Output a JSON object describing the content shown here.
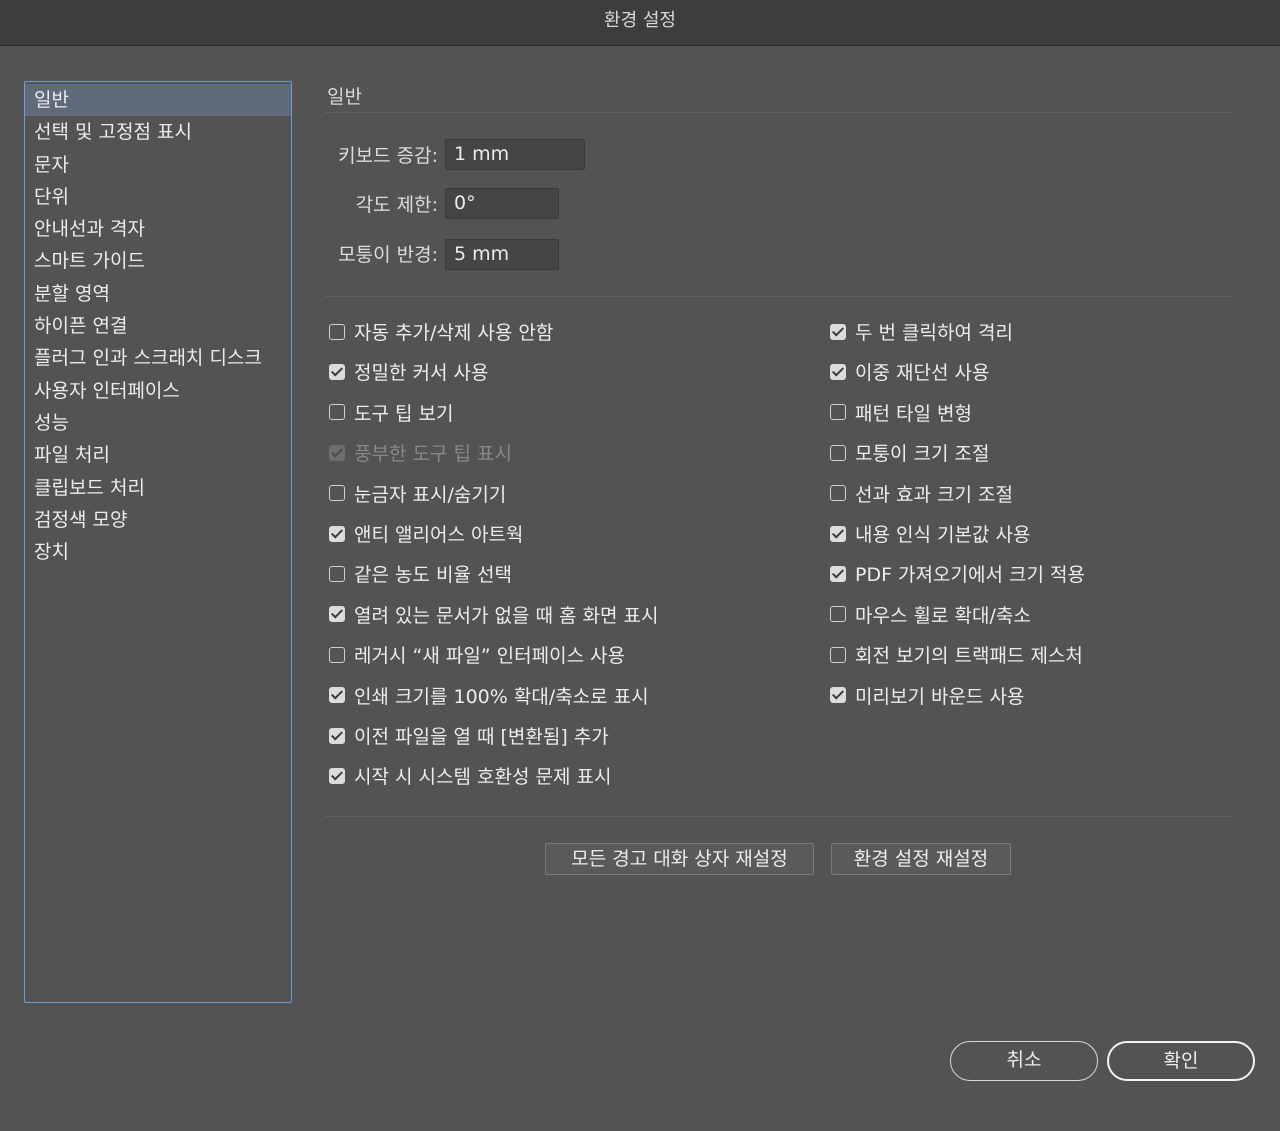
{
  "window": {
    "title": "환경 설정"
  },
  "sidebar": {
    "items": [
      {
        "label": "일반",
        "active": true
      },
      {
        "label": "선택 및 고정점 표시"
      },
      {
        "label": "문자"
      },
      {
        "label": "단위"
      },
      {
        "label": "안내선과 격자"
      },
      {
        "label": "스마트 가이드"
      },
      {
        "label": "분할 영역"
      },
      {
        "label": "하이픈 연결"
      },
      {
        "label": "플러그 인과 스크래치 디스크"
      },
      {
        "label": "사용자 인터페이스"
      },
      {
        "label": "성능"
      },
      {
        "label": "파일 처리"
      },
      {
        "label": "클립보드 처리"
      },
      {
        "label": "검정색 모양"
      },
      {
        "label": "장치"
      }
    ]
  },
  "main": {
    "section_title": "일반",
    "fields": {
      "keyboard_increment": {
        "label": "키보드 증감:",
        "value": "1 mm"
      },
      "constrain_angle": {
        "label": "각도 제한:",
        "value": "0°"
      },
      "corner_radius": {
        "label": "모퉁이 반경:",
        "value": "5 mm"
      }
    },
    "left_options": [
      {
        "label": "자동 추가/삭제 사용 안함",
        "checked": false
      },
      {
        "label": "정밀한 커서 사용",
        "checked": true
      },
      {
        "label": "도구 팁 보기",
        "checked": false
      },
      {
        "label": "풍부한 도구 팁 표시",
        "checked": true,
        "disabled": true
      },
      {
        "label": "눈금자 표시/숨기기",
        "checked": false
      },
      {
        "label": "앤티 앨리어스 아트웍",
        "checked": true
      },
      {
        "label": "같은 농도 비율 선택",
        "checked": false
      },
      {
        "label": "열려 있는 문서가 없을 때 홈 화면 표시",
        "checked": true
      },
      {
        "label": "레거시 “새 파일” 인터페이스 사용",
        "checked": false
      },
      {
        "label": "인쇄 크기를 100% 확대/축소로 표시",
        "checked": true
      },
      {
        "label": "이전 파일을 열 때 [변환됨] 추가",
        "checked": true
      },
      {
        "label": "시작 시 시스템 호환성 문제 표시",
        "checked": true
      }
    ],
    "right_options": [
      {
        "label": "두 번 클릭하여 격리",
        "checked": true
      },
      {
        "label": "이중 재단선 사용",
        "checked": true
      },
      {
        "label": "패턴 타일 변형",
        "checked": false
      },
      {
        "label": "모퉁이 크기 조절",
        "checked": false
      },
      {
        "label": "선과 효과 크기 조절",
        "checked": false
      },
      {
        "label": "내용 인식 기본값 사용",
        "checked": true
      },
      {
        "label": "PDF 가져오기에서 크기 적용",
        "checked": true
      },
      {
        "label": "마우스 휠로 확대/축소",
        "checked": false
      },
      {
        "label": "회전 보기의 트랙패드 제스처",
        "checked": false
      },
      {
        "label": "미리보기 바운드 사용",
        "checked": true
      }
    ],
    "buttons": {
      "reset_warnings": "모든 경고 대화 상자 재설정",
      "reset_preferences": "환경 설정 재설정"
    }
  },
  "footer": {
    "cancel": "취소",
    "ok": "확인"
  }
}
